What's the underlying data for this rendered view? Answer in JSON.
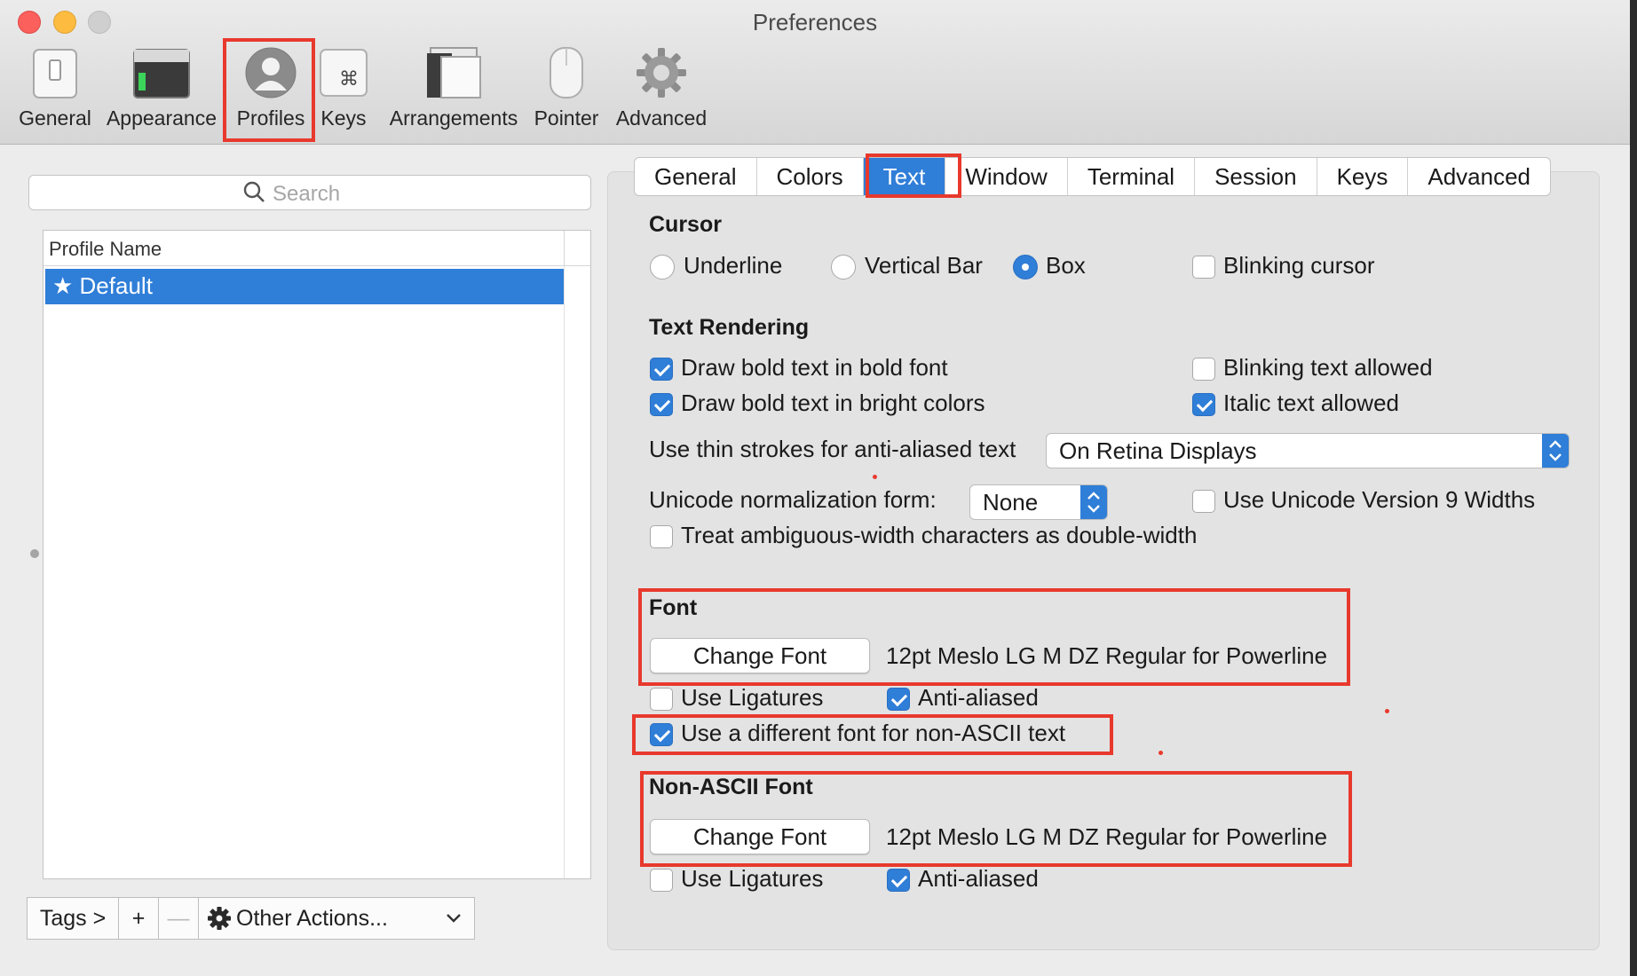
{
  "window": {
    "title": "Preferences"
  },
  "toolbar": {
    "items": [
      {
        "label": "General"
      },
      {
        "label": "Appearance"
      },
      {
        "label": "Profiles"
      },
      {
        "label": "Keys"
      },
      {
        "label": "Arrangements"
      },
      {
        "label": "Pointer"
      },
      {
        "label": "Advanced"
      }
    ],
    "selected": "Profiles"
  },
  "sidebar": {
    "search_placeholder": "Search",
    "column_header": "Profile Name",
    "profiles": [
      {
        "label": "★ Default",
        "selected": true
      }
    ],
    "bottom": {
      "tags": "Tags >",
      "add": "+",
      "remove": "—",
      "other_actions": "Other Actions..."
    }
  },
  "tabs": {
    "items": [
      {
        "label": "General"
      },
      {
        "label": "Colors"
      },
      {
        "label": "Text"
      },
      {
        "label": "Window"
      },
      {
        "label": "Terminal"
      },
      {
        "label": "Session"
      },
      {
        "label": "Keys"
      },
      {
        "label": "Advanced"
      }
    ],
    "selected": "Text"
  },
  "cursor": {
    "heading": "Cursor",
    "options": [
      {
        "label": "Underline",
        "selected": false
      },
      {
        "label": "Vertical Bar",
        "selected": false
      },
      {
        "label": "Box",
        "selected": true
      }
    ],
    "blinking": {
      "label": "Blinking cursor",
      "checked": false
    }
  },
  "text_rendering": {
    "heading": "Text Rendering",
    "bold_font": {
      "label": "Draw bold text in bold font",
      "checked": true
    },
    "bold_bright": {
      "label": "Draw bold text in bright colors",
      "checked": true
    },
    "blinking_text": {
      "label": "Blinking text allowed",
      "checked": false
    },
    "italic_text": {
      "label": "Italic text allowed",
      "checked": true
    },
    "thin_strokes": {
      "label": "Use thin strokes for anti-aliased text",
      "value": "On Retina Displays"
    },
    "unicode_norm": {
      "label": "Unicode normalization form:",
      "value": "None"
    },
    "unicode_v9": {
      "label": "Use Unicode Version 9 Widths",
      "checked": false
    },
    "ambiguous": {
      "label": "Treat ambiguous-width characters as double-width",
      "checked": false
    }
  },
  "font": {
    "heading": "Font",
    "button": "Change Font",
    "value": "12pt Meslo LG M DZ Regular for Powerline",
    "ligatures": {
      "label": "Use Ligatures",
      "checked": false
    },
    "anti_aliased": {
      "label": "Anti-aliased",
      "checked": true
    },
    "different_non_ascii": {
      "label": "Use a different font for non-ASCII text",
      "checked": true
    }
  },
  "non_ascii_font": {
    "heading": "Non-ASCII Font",
    "button": "Change Font",
    "value": "12pt Meslo LG M DZ Regular for Powerline",
    "ligatures": {
      "label": "Use Ligatures",
      "checked": false
    },
    "anti_aliased": {
      "label": "Anti-aliased",
      "checked": true
    }
  },
  "colors": {
    "accent": "#2f7ed8",
    "highlight": "#e8392d"
  }
}
